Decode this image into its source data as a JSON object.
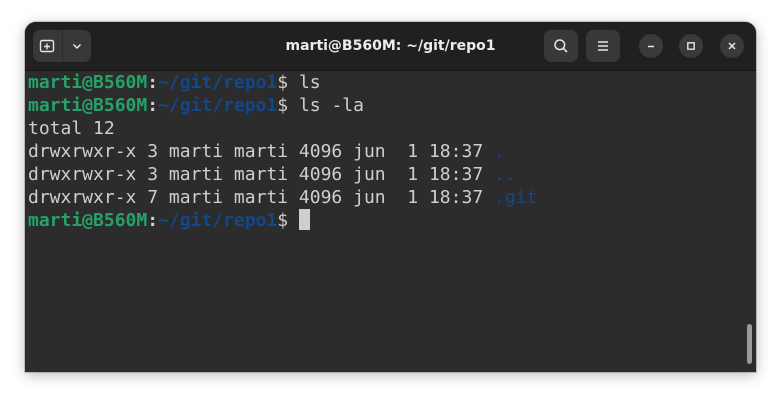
{
  "window": {
    "title": "marti@B560M: ~/git/repo1"
  },
  "header": {
    "new_tab_icon": "new-tab-icon",
    "menu_dropdown_icon": "chevron-down-icon",
    "search_icon": "search-icon",
    "hamburger_icon": "hamburger-menu-icon",
    "minimize_icon": "minimize-icon",
    "maximize_icon": "maximize-icon",
    "close_icon": "close-icon"
  },
  "terminal": {
    "prompt": {
      "user_host": "marti@B560M",
      "colon": ":",
      "path": "~/git/repo1",
      "symbol": "$"
    },
    "commands": [
      " ls",
      " ls -la",
      " "
    ],
    "output": {
      "total": "total 12",
      "rows": [
        {
          "text": "drwxrwxr-x 3 marti marti 4096 jun  1 18:37 ",
          "name": "."
        },
        {
          "text": "drwxrwxr-x 3 marti marti 4096 jun  1 18:37 ",
          "name": ".."
        },
        {
          "text": "drwxrwxr-x 7 marti marti 4096 jun  1 18:37 ",
          "name": ".git"
        }
      ]
    }
  },
  "colors": {
    "prompt_user": "#26a269",
    "prompt_path": "#12488b",
    "directory": "#12488b",
    "text": "#d0cfcc",
    "background": "#2c2c2c",
    "headerbar": "#202020"
  }
}
